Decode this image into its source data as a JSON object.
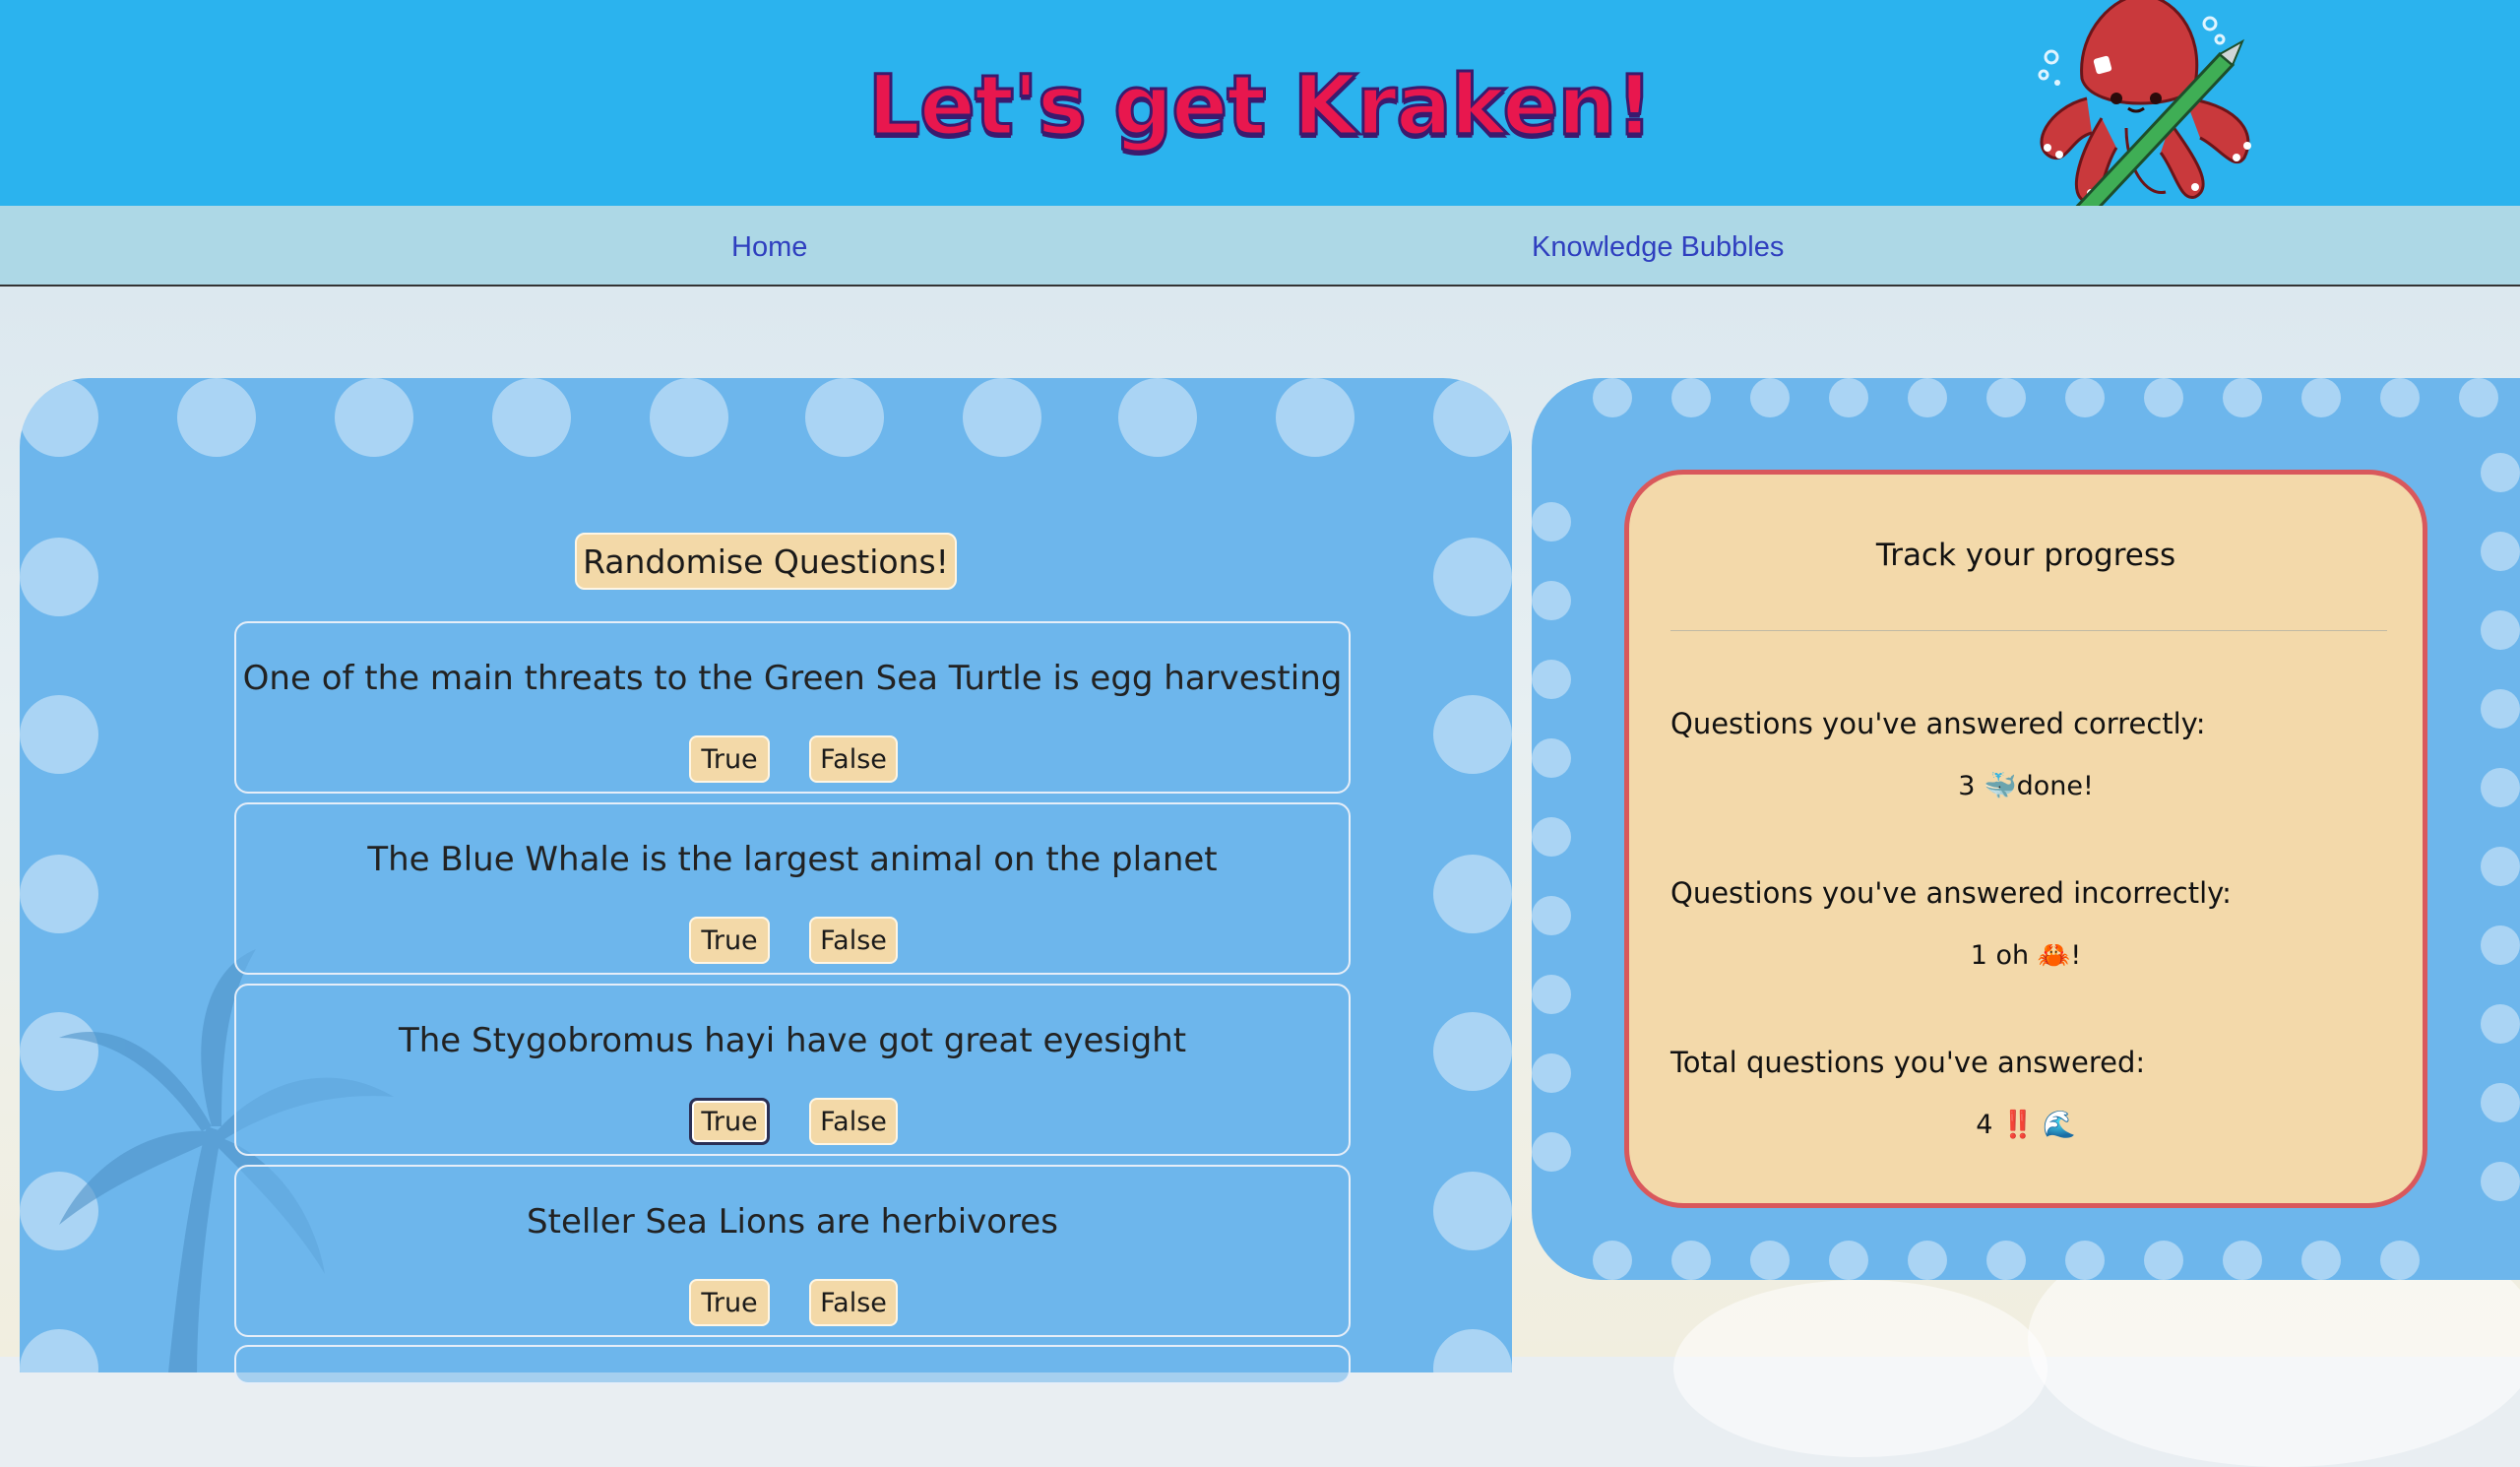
{
  "header": {
    "title": "Let's get Kraken!",
    "mascot_icon": "octopus-with-pen-icon"
  },
  "nav": {
    "items": [
      "Home",
      "Knowledge Bubbles"
    ]
  },
  "quiz": {
    "randomise_label": "Randomise Questions!",
    "questions": [
      {
        "text": "One of the main threats to the Green Sea Turtle is egg harvesting",
        "true_label": "True",
        "false_label": "False"
      },
      {
        "text": "The Blue Whale is the largest animal on the planet",
        "true_label": "True",
        "false_label": "False"
      },
      {
        "text": "The Stygobromus hayi have got great eyesight",
        "true_label": "True",
        "false_label": "False"
      },
      {
        "text": "Steller Sea Lions are herbivores",
        "true_label": "True",
        "false_label": "False"
      }
    ]
  },
  "progress": {
    "title": "Track your progress",
    "correct_label": "Questions you've answered correctly:",
    "correct_value": "3 🐳done!",
    "incorrect_label": "Questions you've answered incorrectly:",
    "incorrect_value": "1 oh 🦀!",
    "total_label": "Total questions you've answered:",
    "total_value": "4 ‼️ 🌊"
  },
  "colors": {
    "header_bg": "#2bb3ee",
    "nav_bg": "#add8e6",
    "panel_bg": "#6db6ec",
    "button_bg": "#f3d9a8",
    "title_red": "#e8174e",
    "card_border": "#d9585c"
  }
}
